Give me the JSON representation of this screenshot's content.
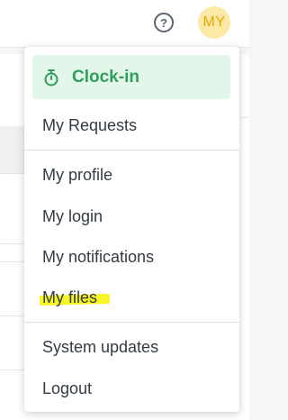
{
  "header": {
    "help_icon": "question-circle-icon",
    "avatar_initials": "MY"
  },
  "menu": {
    "clock_in": {
      "label": "Clock-in",
      "icon": "stopwatch-icon",
      "color": "#2f9e5a",
      "background": "#e3f6ea"
    },
    "items": [
      {
        "label": "My Requests"
      },
      {
        "label": "My profile"
      },
      {
        "label": "My login"
      },
      {
        "label": "My notifications"
      },
      {
        "label": "My files",
        "highlighted": true,
        "highlight_color": "#f7f200"
      },
      {
        "label": "System updates"
      },
      {
        "label": "Logout"
      }
    ]
  }
}
